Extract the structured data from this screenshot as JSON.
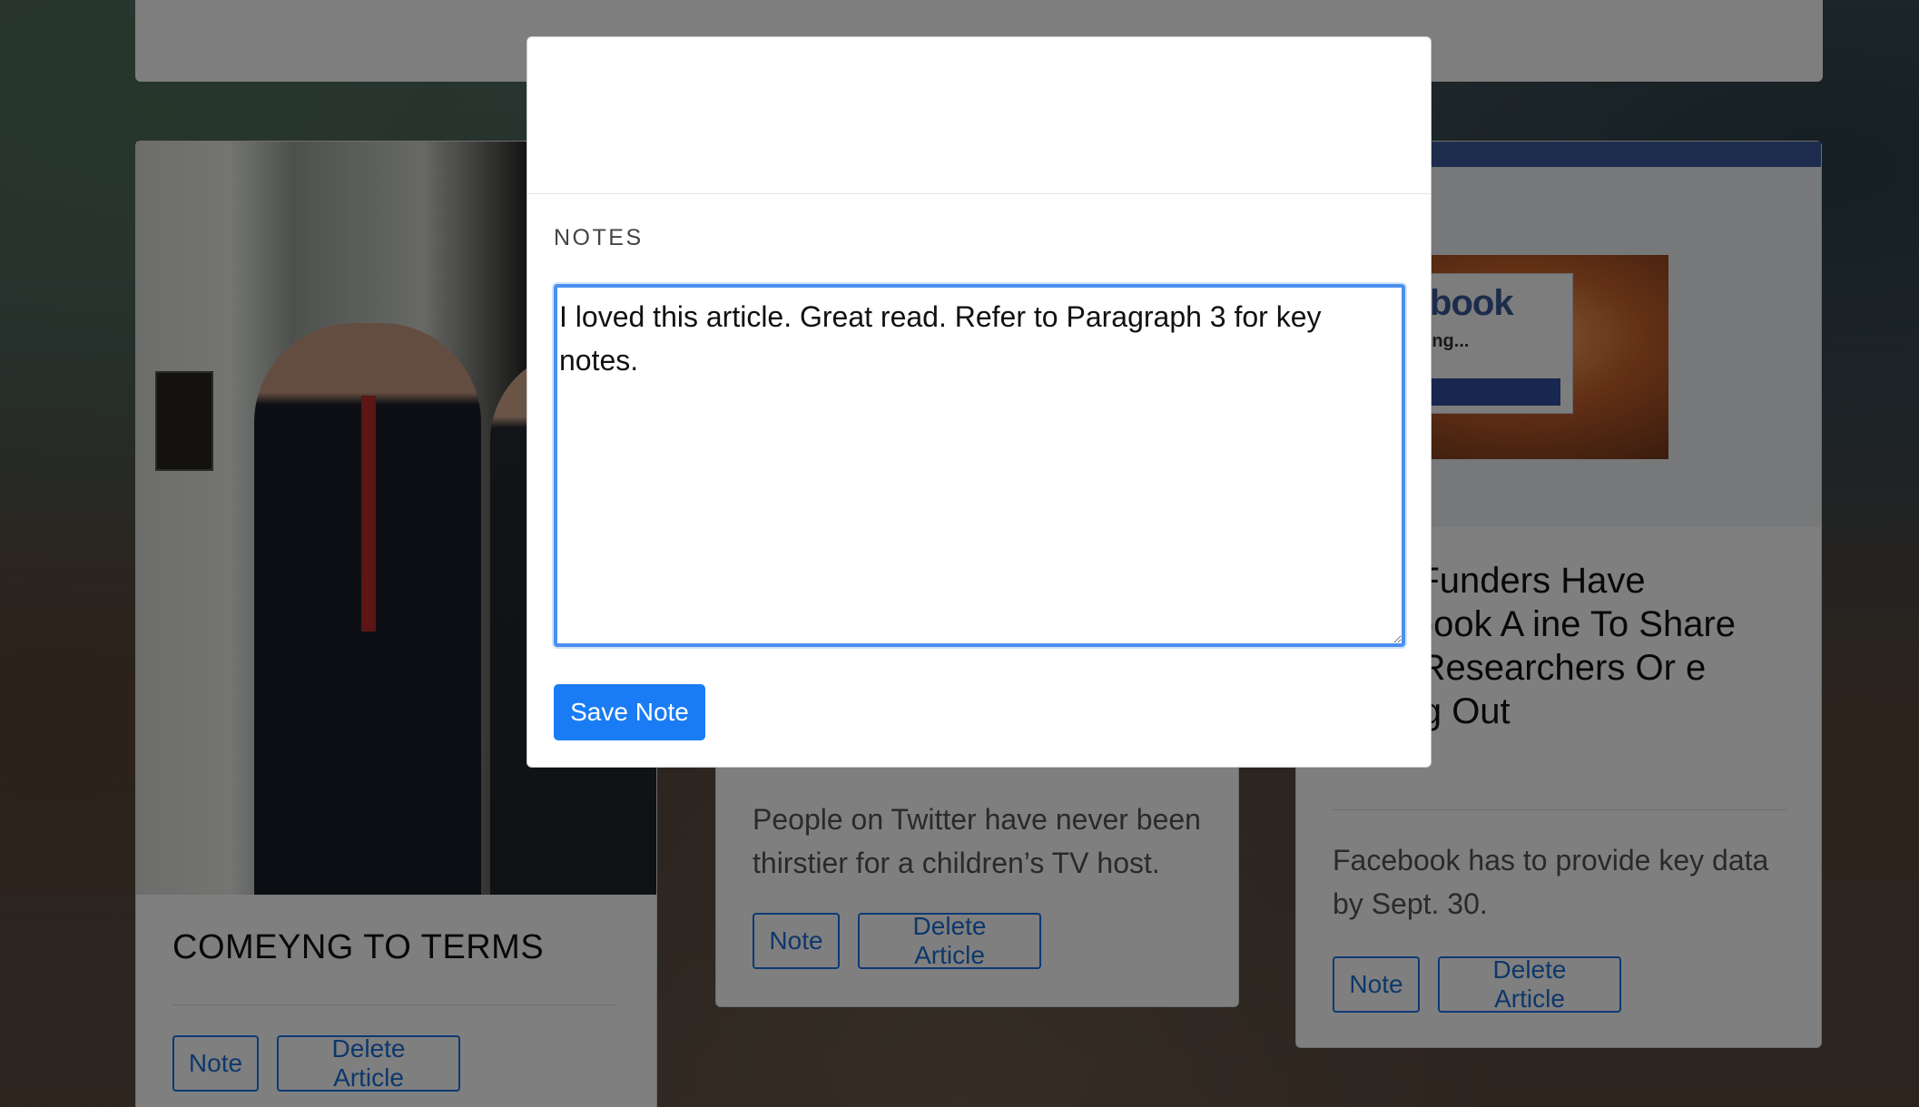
{
  "modal": {
    "section_label": "NOTES",
    "note_text": "I loved this article. Great read. Refer to Paragraph 3 for key notes.",
    "save_label": "Save Note"
  },
  "articles": [
    {
      "title": "COMEYNG TO TERMS",
      "note_label": "Note",
      "delete_label": "Delete Article"
    },
    {
      "summary": "People on Twitter have never been thirstier for a children’s TV host.",
      "note_label": "Note",
      "delete_label": "Delete Article"
    },
    {
      "title": "sive: Funders Have Facebook A ine To Share Data Researchers Or e Pulling Out",
      "summary": "Facebook has to provide key data by Sept. 30.",
      "note_label": "Note",
      "delete_label": "Delete Article",
      "image": {
        "logo_text": "facebook",
        "loading_text": "Loading..."
      }
    }
  ],
  "colors": {
    "primary": "#1a7cf5",
    "focus_ring": "#4a90f0",
    "overlay": "rgba(0,0,0,0.5)"
  }
}
